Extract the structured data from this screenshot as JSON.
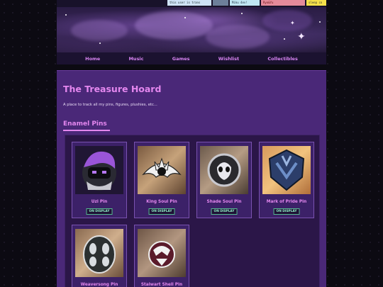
{
  "top_badges": [
    {
      "text": "this user is trans"
    },
    {
      "text": ""
    },
    {
      "text": "Miku 4ev!"
    },
    {
      "text": "Ryo&Yu"
    },
    {
      "text": "sleep co"
    }
  ],
  "nav": {
    "items": [
      {
        "label": "Home"
      },
      {
        "label": "Music"
      },
      {
        "label": "Games"
      },
      {
        "label": "Wishlist"
      },
      {
        "label": "Collectibles"
      }
    ]
  },
  "page": {
    "title": "The Treasure Hoard",
    "intro": "A place to track all my pins, figures, plushies, etc...",
    "section": "Enamel Pins"
  },
  "pins": [
    {
      "name": "Uzi Pin",
      "status": "ON DISPLAY",
      "icon": "uzi-pin-icon"
    },
    {
      "name": "King Soul Pin",
      "status": "ON DISPLAY",
      "icon": "king-soul-pin-icon"
    },
    {
      "name": "Shade Soul Pin",
      "status": "ON DISPLAY",
      "icon": "shade-soul-pin-icon"
    },
    {
      "name": "Mark of Pride Pin",
      "status": "ON DISPLAY",
      "icon": "mark-of-pride-pin-icon"
    },
    {
      "name": "Weaversong Pin",
      "status": "",
      "icon": "weaversong-pin-icon"
    },
    {
      "name": "Stalwart Shell Pin",
      "status": "",
      "icon": "stalwart-shell-pin-icon"
    }
  ],
  "colors": {
    "accent": "#e487ef",
    "panel": "#4a2878",
    "status": "#8ef0c4",
    "background": "#0c0a12"
  }
}
